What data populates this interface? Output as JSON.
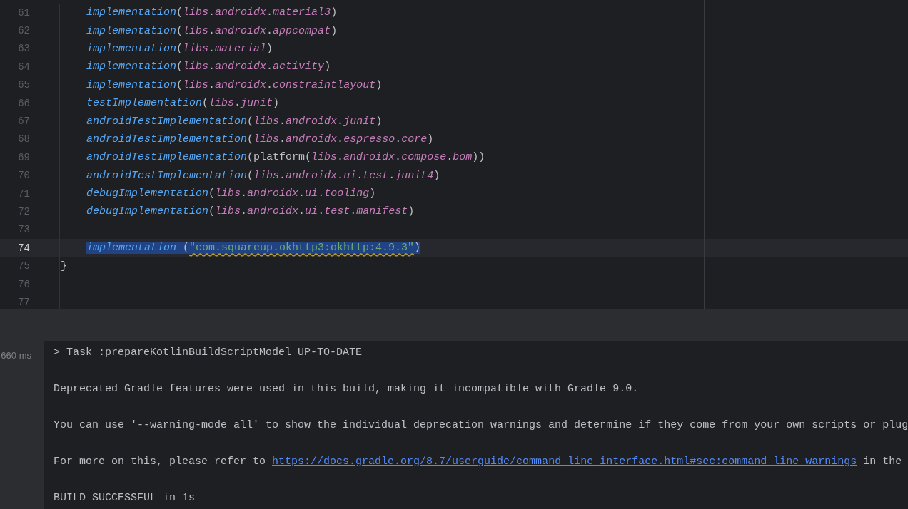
{
  "editor": {
    "lines": [
      {
        "number": "61",
        "selected": false,
        "tokens": [
          {
            "kind": "fn",
            "text": "implementation"
          },
          {
            "kind": "plain",
            "text": "("
          },
          {
            "kind": "lib",
            "text": "libs"
          },
          {
            "kind": "plain",
            "text": "."
          },
          {
            "kind": "lib",
            "text": "androidx"
          },
          {
            "kind": "plain",
            "text": "."
          },
          {
            "kind": "lib",
            "text": "material3"
          },
          {
            "kind": "plain",
            "text": ")"
          }
        ]
      },
      {
        "number": "62",
        "selected": false,
        "tokens": [
          {
            "kind": "fn",
            "text": "implementation"
          },
          {
            "kind": "plain",
            "text": "("
          },
          {
            "kind": "lib",
            "text": "libs"
          },
          {
            "kind": "plain",
            "text": "."
          },
          {
            "kind": "lib",
            "text": "androidx"
          },
          {
            "kind": "plain",
            "text": "."
          },
          {
            "kind": "lib",
            "text": "appcompat"
          },
          {
            "kind": "plain",
            "text": ")"
          }
        ]
      },
      {
        "number": "63",
        "selected": false,
        "tokens": [
          {
            "kind": "fn",
            "text": "implementation"
          },
          {
            "kind": "plain",
            "text": "("
          },
          {
            "kind": "lib",
            "text": "libs"
          },
          {
            "kind": "plain",
            "text": "."
          },
          {
            "kind": "lib",
            "text": "material"
          },
          {
            "kind": "plain",
            "text": ")"
          }
        ]
      },
      {
        "number": "64",
        "selected": false,
        "tokens": [
          {
            "kind": "fn",
            "text": "implementation"
          },
          {
            "kind": "plain",
            "text": "("
          },
          {
            "kind": "lib",
            "text": "libs"
          },
          {
            "kind": "plain",
            "text": "."
          },
          {
            "kind": "lib",
            "text": "androidx"
          },
          {
            "kind": "plain",
            "text": "."
          },
          {
            "kind": "lib",
            "text": "activity"
          },
          {
            "kind": "plain",
            "text": ")"
          }
        ]
      },
      {
        "number": "65",
        "selected": false,
        "tokens": [
          {
            "kind": "fn",
            "text": "implementation"
          },
          {
            "kind": "plain",
            "text": "("
          },
          {
            "kind": "lib",
            "text": "libs"
          },
          {
            "kind": "plain",
            "text": "."
          },
          {
            "kind": "lib",
            "text": "androidx"
          },
          {
            "kind": "plain",
            "text": "."
          },
          {
            "kind": "lib",
            "text": "constraintlayout"
          },
          {
            "kind": "plain",
            "text": ")"
          }
        ]
      },
      {
        "number": "66",
        "selected": false,
        "tokens": [
          {
            "kind": "fn",
            "text": "testImplementation"
          },
          {
            "kind": "plain",
            "text": "("
          },
          {
            "kind": "lib",
            "text": "libs"
          },
          {
            "kind": "plain",
            "text": "."
          },
          {
            "kind": "lib",
            "text": "junit"
          },
          {
            "kind": "plain",
            "text": ")"
          }
        ]
      },
      {
        "number": "67",
        "selected": false,
        "tokens": [
          {
            "kind": "fn",
            "text": "androidTestImplementation"
          },
          {
            "kind": "plain",
            "text": "("
          },
          {
            "kind": "lib",
            "text": "libs"
          },
          {
            "kind": "plain",
            "text": "."
          },
          {
            "kind": "lib",
            "text": "androidx"
          },
          {
            "kind": "plain",
            "text": "."
          },
          {
            "kind": "lib",
            "text": "junit"
          },
          {
            "kind": "plain",
            "text": ")"
          }
        ]
      },
      {
        "number": "68",
        "selected": false,
        "tokens": [
          {
            "kind": "fn",
            "text": "androidTestImplementation"
          },
          {
            "kind": "plain",
            "text": "("
          },
          {
            "kind": "lib",
            "text": "libs"
          },
          {
            "kind": "plain",
            "text": "."
          },
          {
            "kind": "lib",
            "text": "androidx"
          },
          {
            "kind": "plain",
            "text": "."
          },
          {
            "kind": "lib",
            "text": "espresso"
          },
          {
            "kind": "plain",
            "text": "."
          },
          {
            "kind": "lib",
            "text": "core"
          },
          {
            "kind": "plain",
            "text": ")"
          }
        ]
      },
      {
        "number": "69",
        "selected": false,
        "tokens": [
          {
            "kind": "fn",
            "text": "androidTestImplementation"
          },
          {
            "kind": "plain",
            "text": "(platform("
          },
          {
            "kind": "lib",
            "text": "libs"
          },
          {
            "kind": "plain",
            "text": "."
          },
          {
            "kind": "lib",
            "text": "androidx"
          },
          {
            "kind": "plain",
            "text": "."
          },
          {
            "kind": "lib",
            "text": "compose"
          },
          {
            "kind": "plain",
            "text": "."
          },
          {
            "kind": "lib",
            "text": "bom"
          },
          {
            "kind": "plain",
            "text": "))"
          }
        ]
      },
      {
        "number": "70",
        "selected": false,
        "tokens": [
          {
            "kind": "fn",
            "text": "androidTestImplementation"
          },
          {
            "kind": "plain",
            "text": "("
          },
          {
            "kind": "lib",
            "text": "libs"
          },
          {
            "kind": "plain",
            "text": "."
          },
          {
            "kind": "lib",
            "text": "androidx"
          },
          {
            "kind": "plain",
            "text": "."
          },
          {
            "kind": "lib",
            "text": "ui"
          },
          {
            "kind": "plain",
            "text": "."
          },
          {
            "kind": "lib",
            "text": "test"
          },
          {
            "kind": "plain",
            "text": "."
          },
          {
            "kind": "lib",
            "text": "junit4"
          },
          {
            "kind": "plain",
            "text": ")"
          }
        ]
      },
      {
        "number": "71",
        "selected": false,
        "tokens": [
          {
            "kind": "fn",
            "text": "debugImplementation"
          },
          {
            "kind": "plain",
            "text": "("
          },
          {
            "kind": "lib",
            "text": "libs"
          },
          {
            "kind": "plain",
            "text": "."
          },
          {
            "kind": "lib",
            "text": "androidx"
          },
          {
            "kind": "plain",
            "text": "."
          },
          {
            "kind": "lib",
            "text": "ui"
          },
          {
            "kind": "plain",
            "text": "."
          },
          {
            "kind": "lib",
            "text": "tooling"
          },
          {
            "kind": "plain",
            "text": ")"
          }
        ]
      },
      {
        "number": "72",
        "selected": false,
        "tokens": [
          {
            "kind": "fn",
            "text": "debugImplementation"
          },
          {
            "kind": "plain",
            "text": "("
          },
          {
            "kind": "lib",
            "text": "libs"
          },
          {
            "kind": "plain",
            "text": "."
          },
          {
            "kind": "lib",
            "text": "androidx"
          },
          {
            "kind": "plain",
            "text": "."
          },
          {
            "kind": "lib",
            "text": "ui"
          },
          {
            "kind": "plain",
            "text": "."
          },
          {
            "kind": "lib",
            "text": "test"
          },
          {
            "kind": "plain",
            "text": "."
          },
          {
            "kind": "lib",
            "text": "manifest"
          },
          {
            "kind": "plain",
            "text": ")"
          }
        ]
      },
      {
        "number": "73",
        "selected": false
      },
      {
        "number": "74",
        "selected": true,
        "tokens": [
          {
            "kind": "fn",
            "text": "implementation"
          },
          {
            "kind": "plain",
            "text": " ("
          },
          {
            "kind": "string",
            "text": "\"com.squareup.okhttp3:okhttp:4.9.3\"",
            "warning": true
          },
          {
            "kind": "plain",
            "text": ")"
          }
        ]
      },
      {
        "number": "75",
        "selected": false,
        "outdent": true,
        "tokens": [
          {
            "kind": "plain",
            "text": "}"
          }
        ]
      },
      {
        "number": "76",
        "selected": false
      },
      {
        "number": "77",
        "selected": false
      }
    ]
  },
  "console": {
    "duration": "660 ms",
    "lines": [
      {
        "text": "> Task :prepareKotlinBuildScriptModel UP-TO-DATE"
      },
      {
        "text": "Deprecated Gradle features were used in this build, making it incompatible with Gradle 9.0."
      },
      {
        "text": "You can use '--warning-mode all' to show the individual deprecation warnings and determine if they come from your own scripts or plug"
      },
      {
        "text": "For more on this, please refer to ",
        "link": "https://docs.gradle.org/8.7/userguide/command_line_interface.html#sec:command_line_warnings",
        "after": " in the"
      },
      {
        "text": "BUILD SUCCESSFUL in 1s"
      }
    ]
  }
}
